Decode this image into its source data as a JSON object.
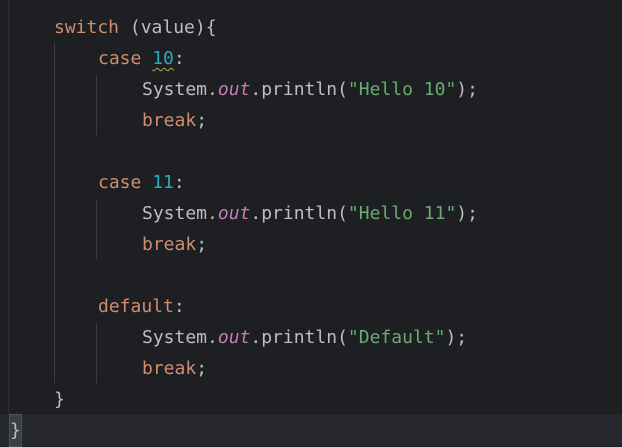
{
  "code": {
    "l1": {
      "kw": "switch",
      "rest": " (value){"
    },
    "l2": {
      "kw": "case",
      "num": "10",
      "colon": ":"
    },
    "l3": {
      "obj": "System.",
      "field": "out",
      "call": ".println(",
      "str": "\"Hello 10\"",
      "end": ");"
    },
    "l4": {
      "kw": "break",
      "end": ";"
    },
    "l6": {
      "kw": "case",
      "num": "11",
      "colon": ":"
    },
    "l7": {
      "obj": "System.",
      "field": "out",
      "call": ".println(",
      "str": "\"Hello 11\"",
      "end": ");"
    },
    "l8": {
      "kw": "break",
      "end": ";"
    },
    "l10": {
      "kw": "default",
      "colon": ":"
    },
    "l11": {
      "obj": "System.",
      "field": "out",
      "call": ".println(",
      "str": "\"Default\"",
      "end": ");"
    },
    "l12": {
      "kw": "break",
      "end": ";"
    },
    "l13": {
      "brace": "}"
    },
    "l14": {
      "brace": "}"
    }
  },
  "colors": {
    "background": "#1e1f22",
    "keyword": "#cf8e6d",
    "number": "#2aacb8",
    "string": "#6aab73",
    "static_field": "#c77dbb",
    "plain": "#bcbec4"
  }
}
